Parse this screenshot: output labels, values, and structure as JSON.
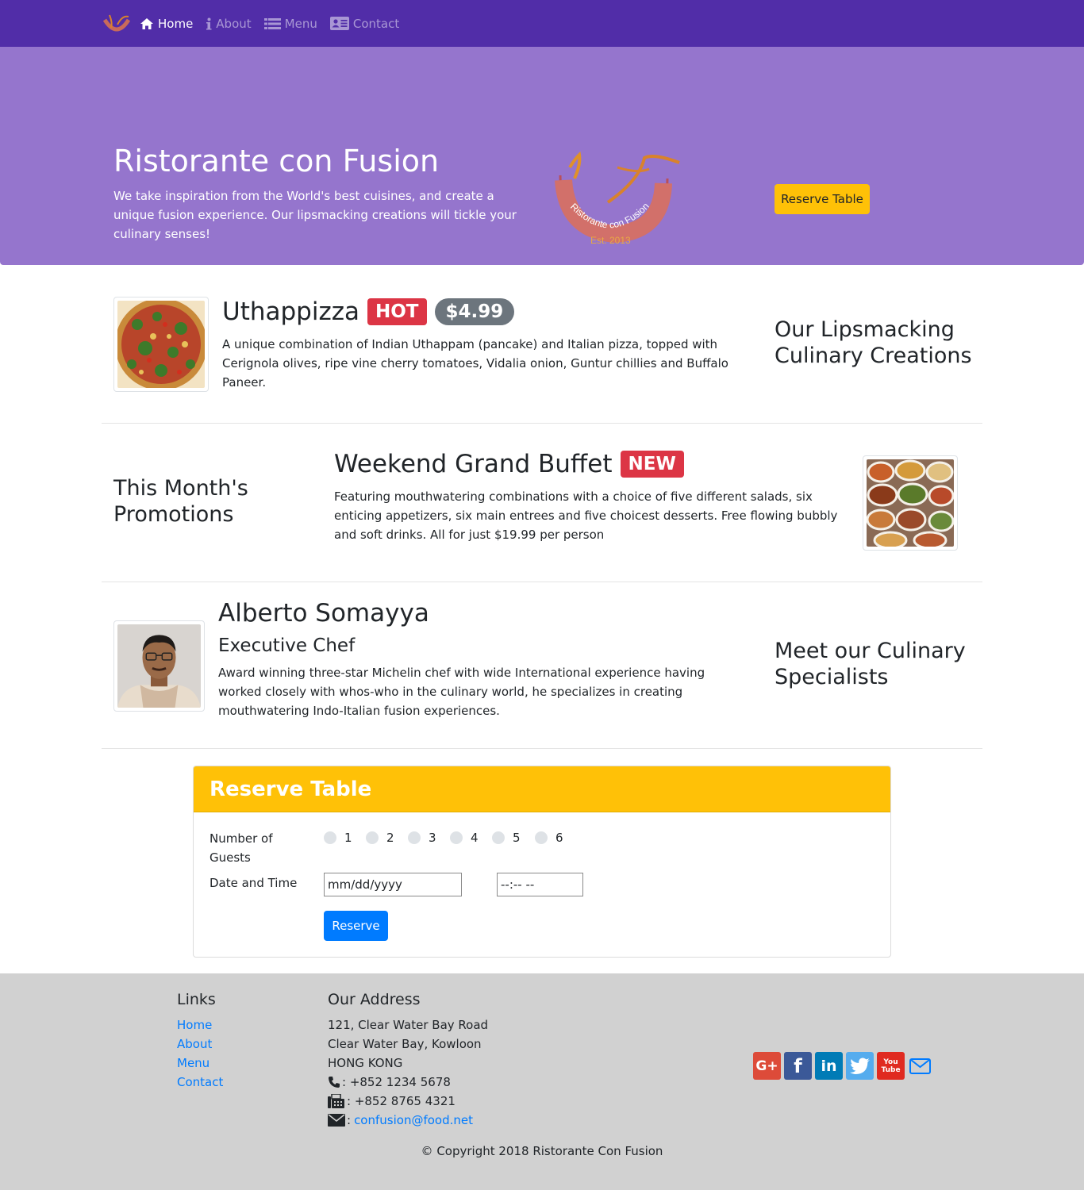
{
  "nav": {
    "items": [
      {
        "label": "Home",
        "icon": "home-icon",
        "active": true
      },
      {
        "label": "About",
        "icon": "info-icon",
        "active": false
      },
      {
        "label": "Menu",
        "icon": "list-icon",
        "active": false
      },
      {
        "label": "Contact",
        "icon": "address-card-icon",
        "active": false
      }
    ]
  },
  "jumbotron": {
    "title": "Ristorante con Fusion",
    "text": "We take inspiration from the World's best cuisines, and create a unique fusion experience. Our lipsmacking creations will tickle your culinary senses!",
    "logo_text": "Ristorante con Fusion",
    "logo_est": "Est. 2013",
    "reserve_button": "Reserve Table"
  },
  "featured": {
    "dish": {
      "name": "Uthappizza",
      "badge": "HOT",
      "price": "$4.99",
      "description": "A unique combination of Indian Uthappam (pancake) and Italian pizza, topped with Cerignola olives, ripe vine cherry tomatoes, Vidalia onion, Guntur chillies and Buffalo Paneer.",
      "side_heading": "Our Lipsmacking Culinary Creations"
    },
    "promotion": {
      "name": "Weekend Grand Buffet",
      "badge": "NEW",
      "description": "Featuring mouthwatering combinations with a choice of five different salads, six enticing appetizers, six main entrees and five choicest desserts. Free flowing bubbly and soft drinks. All for just $19.99 per person",
      "side_heading": "This Month's Promotions"
    },
    "leader": {
      "name": "Alberto Somayya",
      "designation": "Executive Chef",
      "description": "Award winning three-star Michelin chef with wide International experience having worked closely with whos-who in the culinary world, he specializes in creating mouthwatering Indo-Italian fusion experiences.",
      "side_heading": "Meet our Culinary Specialists"
    }
  },
  "reserve_form": {
    "title": "Reserve Table",
    "guests_label": "Number of Guests",
    "guest_options": [
      "1",
      "2",
      "3",
      "4",
      "5",
      "6"
    ],
    "date_label": "Date and Time",
    "date_placeholder": "mm/dd/yyyy",
    "time_placeholder": "--:-- --",
    "submit": "Reserve"
  },
  "footer": {
    "links_title": "Links",
    "links": [
      "Home",
      "About",
      "Menu",
      "Contact"
    ],
    "address_title": "Our Address",
    "address_lines": [
      "121, Clear Water Bay Road",
      "Clear Water Bay, Kowloon",
      "HONG KONG"
    ],
    "phone": ": +852 1234 5678",
    "fax": ": +852 8765 4321",
    "email_prefix": ":",
    "email": "confusion@food.net",
    "social": [
      {
        "name": "google-plus-icon",
        "color": "#DD4B39",
        "glyph": "G+"
      },
      {
        "name": "facebook-icon",
        "color": "#3B5998",
        "glyph": "f"
      },
      {
        "name": "linkedin-icon",
        "color": "#007BB6",
        "glyph": "in"
      },
      {
        "name": "twitter-icon",
        "color": "#55ACEE",
        "glyph": "t"
      },
      {
        "name": "youtube-icon",
        "color": "#E02A20",
        "glyph": "You Tube"
      }
    ],
    "copyright": "© Copyright 2018 Ristorante Con Fusion"
  },
  "colors": {
    "navbar": "#512DA8",
    "jumbotron": "#9575CD",
    "warning": "#FFC107",
    "primary": "#007BFF",
    "danger": "#DC3545",
    "secondary": "#6C757D",
    "footer": "#D1D1D1"
  }
}
